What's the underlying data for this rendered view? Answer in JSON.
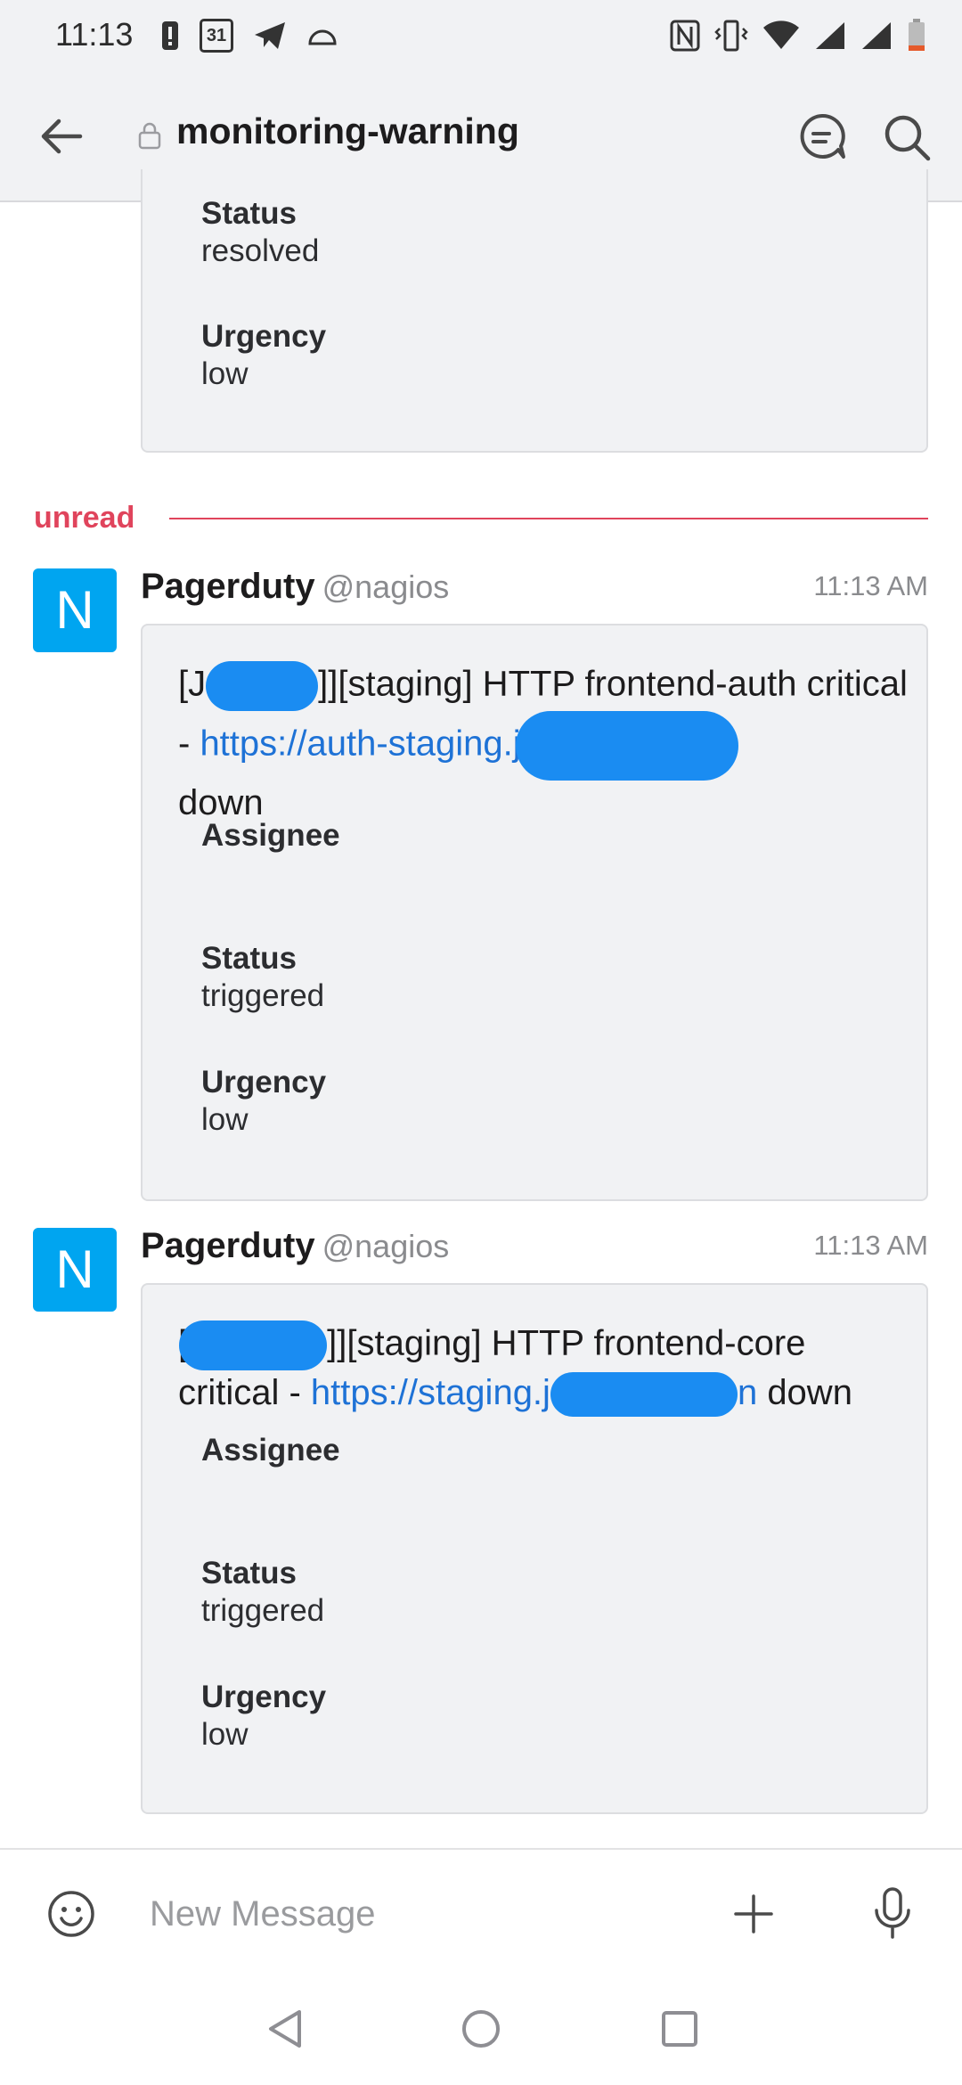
{
  "status_bar": {
    "time": "11:13",
    "calendar_day": "31"
  },
  "header": {
    "channel_name": "monitoring-warning"
  },
  "previous_message": {
    "status_label": "Status",
    "status_value": "resolved",
    "urgency_label": "Urgency",
    "urgency_value": "low"
  },
  "unread_divider": {
    "label": "unread"
  },
  "messages": [
    {
      "sender": "Pagerduty",
      "handle": "@nagios",
      "time": "11:13 AM",
      "avatar_letter": "N",
      "text_prefix": "[J",
      "text_mid": "]][staging] HTTP frontend-auth critical - ",
      "link": "https://auth-staging.j",
      "text_suffix": "down",
      "assignee_label": "Assignee",
      "status_label": "Status",
      "status_value": "triggered",
      "urgency_label": "Urgency",
      "urgency_value": "low"
    },
    {
      "sender": "Pagerduty",
      "handle": "@nagios",
      "time": "11:13 AM",
      "avatar_letter": "N",
      "text_prefix": "[",
      "text_mid": "]][staging] HTTP frontend-core critical - ",
      "link": "https://staging.j",
      "link_tail": "n",
      "text_suffix": "down",
      "assignee_label": "Assignee",
      "status_label": "Status",
      "status_value": "triggered",
      "urgency_label": "Urgency",
      "urgency_value": "low"
    }
  ],
  "composer": {
    "placeholder": "New Message"
  },
  "colors": {
    "accent_red": "#e0445c",
    "link_blue": "#1e72d6",
    "avatar_blue": "#00a5f0",
    "redaction_blue": "#1a8cf2"
  }
}
